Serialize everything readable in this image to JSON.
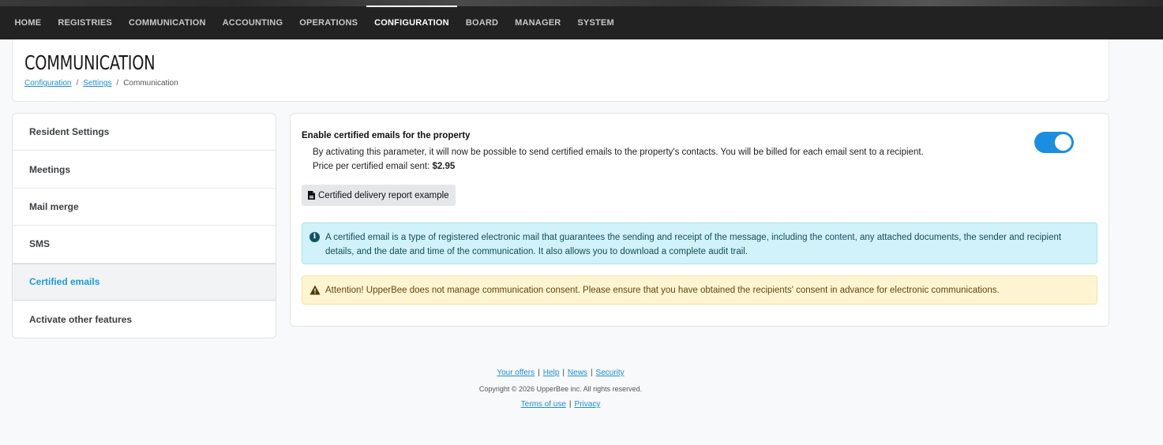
{
  "nav": {
    "items": [
      {
        "label": "HOME",
        "active": false
      },
      {
        "label": "REGISTRIES",
        "active": false
      },
      {
        "label": "COMMUNICATION",
        "active": false
      },
      {
        "label": "ACCOUNTING",
        "active": false
      },
      {
        "label": "OPERATIONS",
        "active": false
      },
      {
        "label": "CONFIGURATION",
        "active": true
      },
      {
        "label": "BOARD",
        "active": false
      },
      {
        "label": "MANAGER",
        "active": false
      },
      {
        "label": "SYSTEM",
        "active": false
      }
    ]
  },
  "header": {
    "title": "COMMUNICATION",
    "breadcrumb": {
      "configuration": "Configuration",
      "settings": "Settings",
      "current": "Communication",
      "separator": "/"
    }
  },
  "sidebar": {
    "items": [
      {
        "label": "Resident Settings",
        "active": false
      },
      {
        "label": "Meetings",
        "active": false
      },
      {
        "label": "Mail merge",
        "active": false
      },
      {
        "label": "SMS",
        "active": false
      },
      {
        "label": "Certified emails",
        "active": true
      },
      {
        "label": "Activate other features",
        "active": false
      }
    ]
  },
  "main": {
    "setting_title": "Enable certified emails for the property",
    "setting_desc": "By activating this parameter, it will now be possible to send certified emails to the property's contacts. You will be billed for each email sent to a recipient. Price per certified email sent: ",
    "price": "$2.95",
    "toggle_on": true,
    "report_button": "Certified delivery report example",
    "info_alert": "A certified email is a type of registered electronic mail that guarantees the sending and receipt of the message, including the content, any attached documents, the sender and recipient details, and the date and time of the communication. It also allows you to download a complete audit trail.",
    "warning_alert": "Attention! UpperBee does not manage communication consent. Please ensure that you have obtained the recipients' consent in advance for electronic communications."
  },
  "footer": {
    "links_top": [
      "Your offers",
      "Help",
      "News",
      "Security"
    ],
    "copyright": "Copyright © 2026 UpperBee inc. All rights reserved.",
    "links_bottom": [
      "Terms of use",
      "Privacy"
    ],
    "separator": "|"
  },
  "colors": {
    "nav_bg": "#222222",
    "accent": "#1a8fe0",
    "active_side": "#1e9ad6",
    "info_bg": "#d1f2fa",
    "warning_bg": "#fff4d2"
  }
}
